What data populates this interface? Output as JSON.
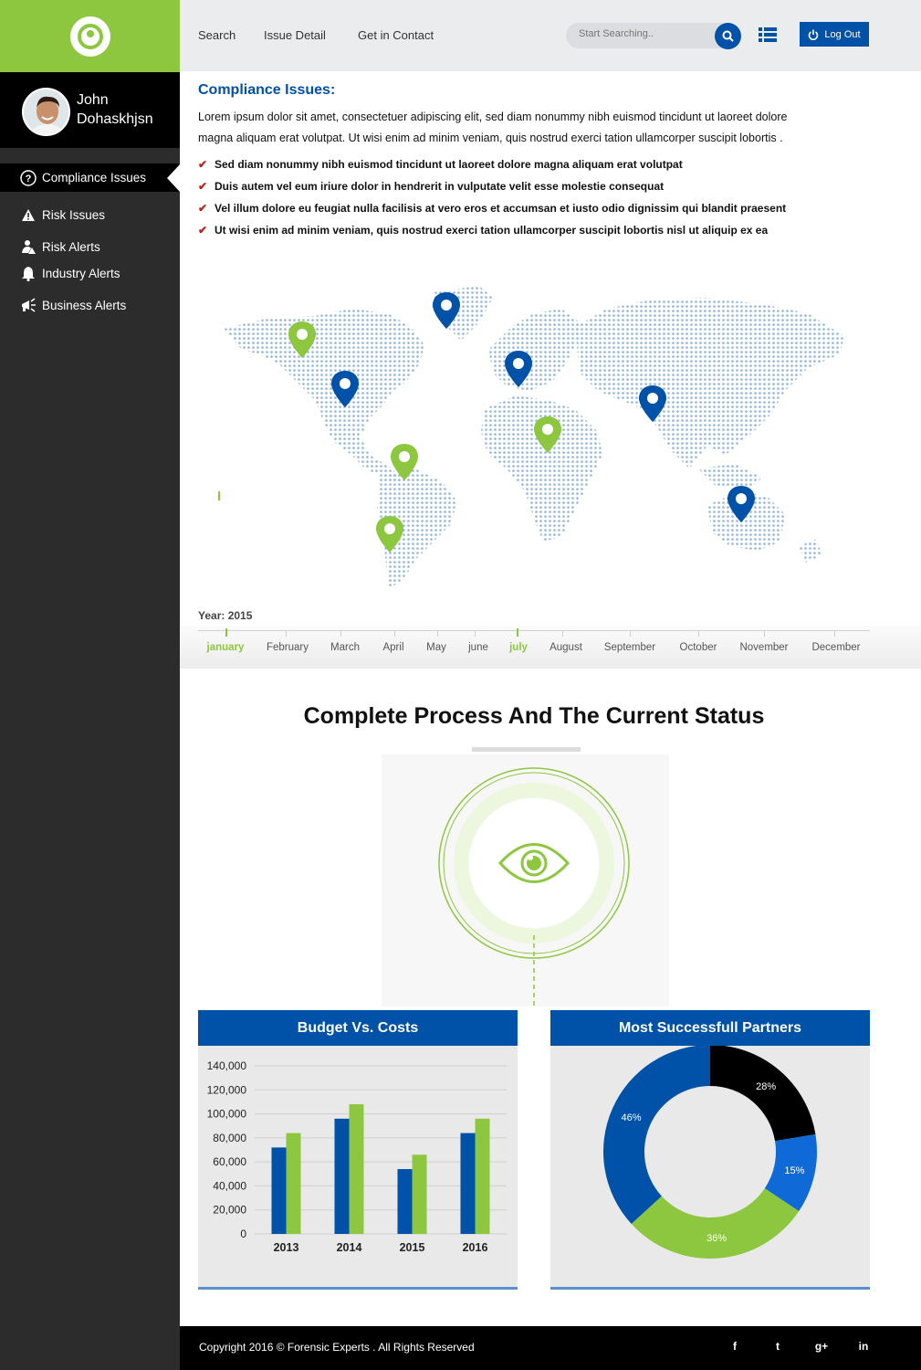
{
  "sidebar": {
    "user_name": "John Dohaskhjsn",
    "items": [
      {
        "label": "Compliance Issues",
        "icon": "question-icon",
        "active": true
      },
      {
        "label": "Risk Issues",
        "icon": "warning-icon"
      },
      {
        "label": "Risk Alerts",
        "icon": "person-alert-icon"
      },
      {
        "label": "Industry Alerts",
        "icon": "bell-icon"
      },
      {
        "label": "Business Alerts",
        "icon": "megaphone-icon"
      }
    ]
  },
  "header": {
    "nav": [
      "Search",
      "Issue Detail",
      "Get in Contact"
    ],
    "search_placeholder": "Start Searching..",
    "logout_label": "Log Out"
  },
  "content": {
    "title": "Compliance Issues:",
    "paragraph": "Lorem ipsum dolor sit amet, consectetuer adipiscing elit, sed diam nonummy nibh euismod tincidunt ut laoreet dolore magna aliquam erat volutpat. Ut wisi enim ad minim veniam, quis nostrud exerci tation ullamcorper suscipit lobortis .",
    "bullets": [
      "Sed diam nonummy nibh euismod tincidunt ut laoreet dolore magna aliquam erat volutpat",
      "Duis autem vel eum iriure dolor in hendrerit in vulputate velit esse molestie consequat",
      "Vel illum dolore eu feugiat nulla facilisis at vero eros et accumsan et iusto odio dignissim qui blandit praesent",
      "Ut wisi enim ad minim veniam, quis nostrud exerci tation ullamcorper suscipit lobortis nisl ut aliquip ex ea"
    ]
  },
  "timeline": {
    "year_label": "Year: 2015",
    "months": [
      "january",
      "February",
      "March",
      "April",
      "May",
      "june",
      "july",
      "August",
      "September",
      "October",
      "November",
      "December"
    ],
    "highlighted": [
      "january",
      "july"
    ]
  },
  "process": {
    "title": "Complete Process And The Current Status"
  },
  "colors": {
    "brand_blue": "#0051a8",
    "brand_green": "#8dc63f",
    "sidebar_bg": "#2c2c2c"
  },
  "budget_chart": {
    "title": "Budget Vs. Costs"
  },
  "partners_chart": {
    "title": "Most Successfull Partners"
  },
  "chart_data": [
    {
      "type": "bar",
      "title": "Budget Vs. Costs",
      "categories": [
        "2013",
        "2014",
        "2015",
        "2016"
      ],
      "series": [
        {
          "values": [
            72000,
            96000,
            54000,
            84000
          ],
          "color": "#0051a8"
        },
        {
          "values": [
            84000,
            108000,
            66000,
            96000
          ],
          "color": "#8dc63f"
        }
      ],
      "ylim": [
        0,
        140000
      ],
      "yticks": [
        "0",
        "20,000",
        "40,000",
        "60,000",
        "80,000",
        "100,000",
        "120,000",
        "140,000"
      ],
      "grid": true
    },
    {
      "type": "pie",
      "title": "Most Successfull Partners",
      "slices": [
        {
          "label": "28%",
          "value": 28,
          "color": "#000000"
        },
        {
          "label": "15%",
          "value": 15,
          "color": "#0f6ad8"
        },
        {
          "label": "36%",
          "value": 36,
          "color": "#8dc63f"
        },
        {
          "label": "46%",
          "value": 46,
          "color": "#0051a8"
        }
      ]
    }
  ],
  "footer": {
    "copyright": "Copyright 2016 © Forensic Experts . All Rights Reserved",
    "social": [
      {
        "label": "f",
        "icon": "facebook-icon"
      },
      {
        "label": "t",
        "icon": "twitter-icon"
      },
      {
        "label": "g+",
        "icon": "google-plus-icon"
      },
      {
        "label": "in",
        "icon": "linkedin-icon"
      }
    ]
  }
}
